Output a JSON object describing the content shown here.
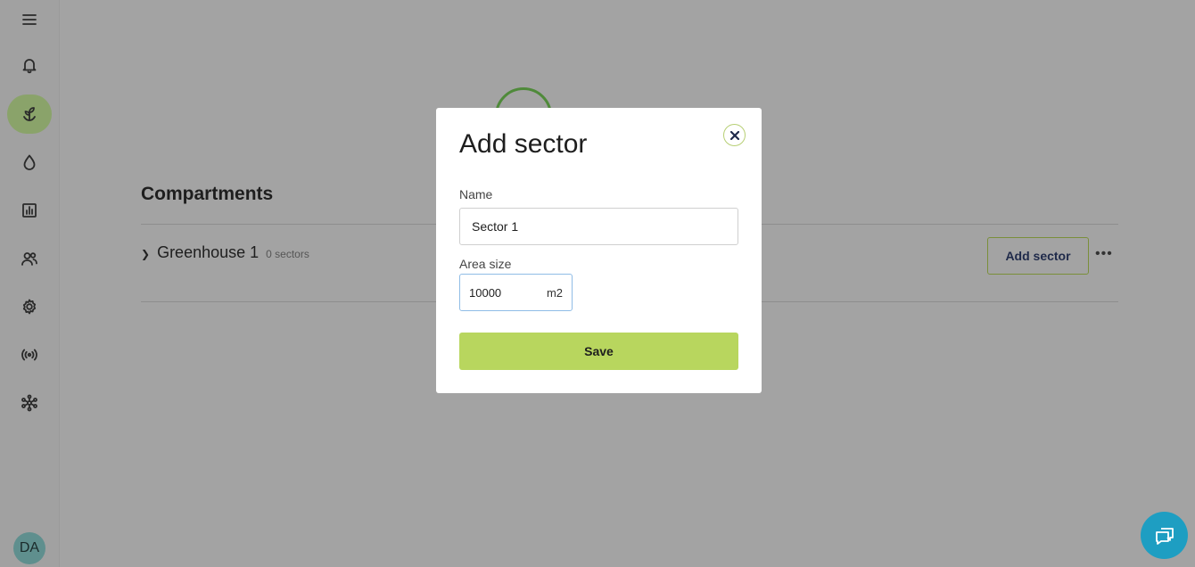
{
  "sidebar": {
    "items": [
      {
        "icon": "menu-icon"
      },
      {
        "icon": "bell-icon"
      },
      {
        "icon": "plant-icon",
        "active": true
      },
      {
        "icon": "water-drop-icon"
      },
      {
        "icon": "chart-icon"
      },
      {
        "icon": "users-icon"
      },
      {
        "icon": "gear-icon"
      },
      {
        "icon": "radio-signal-icon"
      },
      {
        "icon": "network-icon"
      }
    ],
    "avatar": "DA"
  },
  "main": {
    "section_title": "Compartments",
    "compartments": [
      {
        "name": "Greenhouse 1",
        "count": "0 sectors"
      }
    ],
    "add_sector_label": "Add sector",
    "more_label": "•••"
  },
  "modal": {
    "title": "Add sector",
    "name_label": "Name",
    "name_value": "Sector 1",
    "area_label": "Area size",
    "area_value": "10000",
    "area_unit": "m2",
    "save_label": "Save"
  },
  "colors": {
    "accent": "#b8d65e",
    "chat": "#1e9ec2",
    "overlay": "#a3a3a3"
  }
}
